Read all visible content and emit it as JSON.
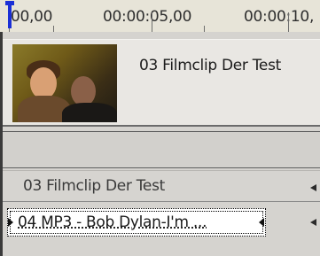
{
  "ruler": {
    "labels": [
      "00,00",
      "00:00:05,00",
      "00:00:10,"
    ]
  },
  "tracks": {
    "video_clip": {
      "title": "03 Filmclip Der Test",
      "thumbnail": "two-people-video-frame"
    },
    "audio_clips": [
      {
        "title": "03 Filmclip Der Test",
        "selected": false
      },
      {
        "title": "04 MP3 - Bob Dylan-I'm ...",
        "selected": true
      }
    ]
  },
  "colors": {
    "playhead": "#1a2fd6",
    "ruler_bg": "#e7e4d8",
    "track_bg": "#d5d3cf",
    "selected_clip_bg": "#ffffff"
  },
  "icons": {
    "playhead": "playhead-marker-icon",
    "track_arrow": "left-arrow-icon",
    "clip_handle": "triangle-handle-icon"
  }
}
